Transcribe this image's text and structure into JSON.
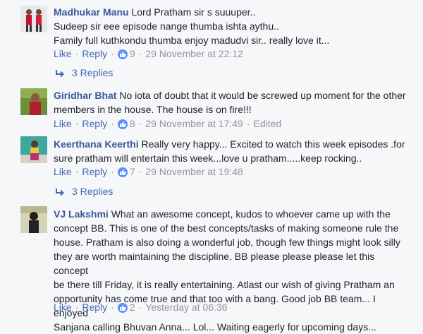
{
  "comments": [
    {
      "name": "Madhukar Manu",
      "lines": [
        "Lord Pratham sir s suuuper..",
        "Sudeep sir eee episode nange thumba ishta aythu..",
        "Family full kuthkondu thumba enjoy madudvi sir.. really love it..."
      ],
      "like": "Like",
      "reply": "Reply",
      "reactions": "9",
      "time": "29 November at 22:12",
      "edited": "",
      "replies": "3 Replies"
    },
    {
      "name": "Giridhar Bhat",
      "lines": [
        "No iota of doubt that it would be screwed up moment for the other",
        "members in the house. The house is on fire!!!"
      ],
      "like": "Like",
      "reply": "Reply",
      "reactions": "8",
      "time": "29 November at 17:49",
      "edited": "Edited",
      "replies": ""
    },
    {
      "name": "Keerthana Keerthi",
      "lines": [
        "Really very happy... Excited to watch this week episodes .for",
        "sure pratham will entertain this week...love u pratham.....keep rocking.."
      ],
      "like": "Like",
      "reply": "Reply",
      "reactions": "7",
      "time": "29 November at 19:48",
      "edited": "",
      "replies": "3 Replies"
    },
    {
      "name": "VJ Lakshmi",
      "lines": [
        "What an awesome concept, kudos to whoever came up with the",
        "concept BB. This is one of the best concepts/tasks of making someone rule the",
        "house. Pratham is also doing a wonderful job, though few things might look silly",
        "they are worth maintaining the discipline. BB please please please let this concept",
        "be there till Friday, it is really entertaining. Atlast our wish of giving Pratham an",
        "opportunity has come true and that too with a bang. Good job BB team... I enjoyed",
        "Sanjana calling Bhuvan Anna... Lol... Waiting eagerly for upcoming days..."
      ],
      "like": "Like",
      "reply": "Reply",
      "reactions": "2",
      "time": "Yesterday at 06:36",
      "edited": "",
      "replies": ""
    }
  ]
}
